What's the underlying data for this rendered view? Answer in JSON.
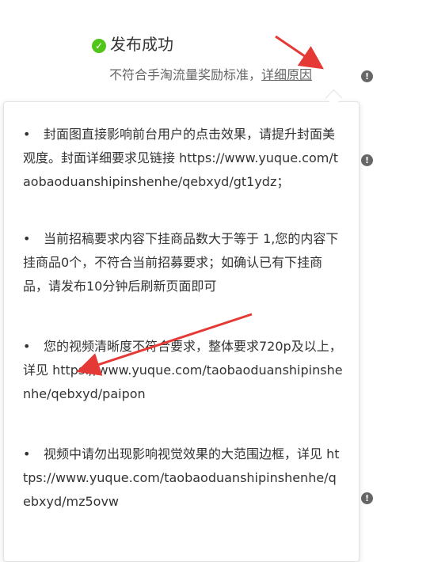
{
  "status": {
    "title": "发布成功",
    "subtitle_prefix": "不符合手淘流量奖励标准，",
    "detail_link": "详细原因"
  },
  "icons": {
    "success": "check-circle-icon",
    "info": "exclamation-circle-icon",
    "success_color": "#52c41a",
    "info_color": "#666666",
    "arrow_color": "#e53935"
  },
  "reasons": [
    {
      "text": "封面图直接影响前台用户的点击效果，请提升封面美观度。封面详细要求见链接 https://www.yuque.com/taobaoduanshipinshenhe/qebxyd/gt1ydz；"
    },
    {
      "text": "当前招稿要求内容下挂商品数大于等于 1,您的内容下挂商品0个，不符合当前招募要求；如确认已有下挂商品，请发布10分钟后刷新页面即可"
    },
    {
      "text": "您的视频清晰度不符合要求，整体要求720p及以上，详见 https://www.yuque.com/taobaoduanshipinshenhe/qebxyd/paipon"
    },
    {
      "text": "视频中请勿出现影响视觉效果的大范围边框，详见 https://www.yuque.com/taobaoduanshipinshenhe/qebxyd/mz5ovw"
    }
  ]
}
